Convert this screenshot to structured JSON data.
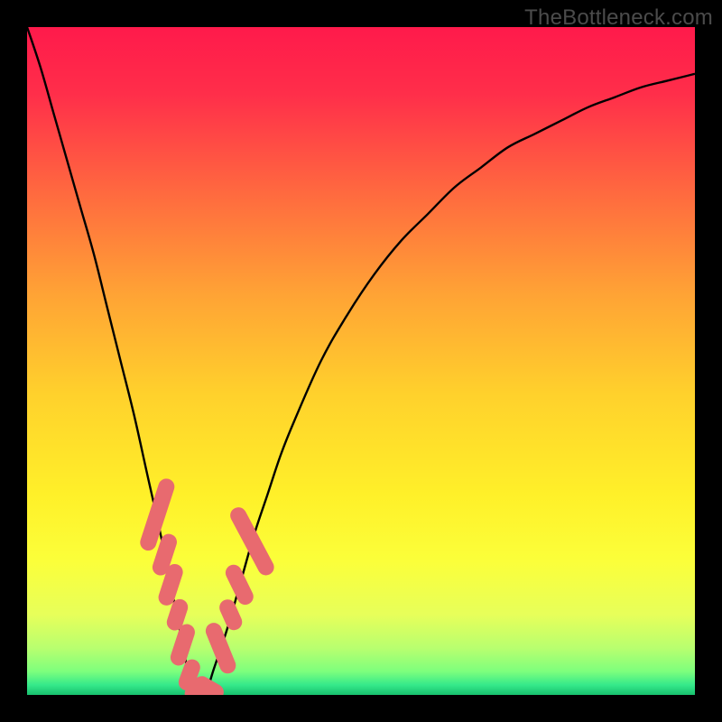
{
  "watermark": "TheBottleneck.com",
  "chart_data": {
    "type": "line",
    "title": "",
    "xlabel": "",
    "ylabel": "",
    "xlim": [
      0,
      100
    ],
    "ylim": [
      0,
      100
    ],
    "series": [
      {
        "name": "bottleneck-curve",
        "x": [
          0,
          2,
          4,
          6,
          8,
          10,
          12,
          14,
          16,
          18,
          20,
          22,
          23,
          24,
          25,
          26,
          27,
          28,
          30,
          32,
          34,
          36,
          38,
          40,
          44,
          48,
          52,
          56,
          60,
          64,
          68,
          72,
          76,
          80,
          84,
          88,
          92,
          96,
          100
        ],
        "y": [
          100,
          94,
          87,
          80,
          73,
          66,
          58,
          50,
          42,
          33,
          24,
          14,
          9,
          4,
          1,
          0,
          1,
          4,
          10,
          17,
          24,
          30,
          36,
          41,
          50,
          57,
          63,
          68,
          72,
          76,
          79,
          82,
          84,
          86,
          88,
          89.5,
          91,
          92,
          93
        ]
      }
    ],
    "markers": [
      {
        "name": "left-cluster-1",
        "x": 19.5,
        "y": 27,
        "len": 7,
        "angle": -72
      },
      {
        "name": "left-cluster-2",
        "x": 20.6,
        "y": 21,
        "len": 4,
        "angle": -72
      },
      {
        "name": "left-cluster-3",
        "x": 21.5,
        "y": 16.5,
        "len": 4,
        "angle": -72
      },
      {
        "name": "left-cluster-4",
        "x": 22.5,
        "y": 12,
        "len": 3,
        "angle": -72
      },
      {
        "name": "left-cluster-5",
        "x": 23.3,
        "y": 7.5,
        "len": 4,
        "angle": -72
      },
      {
        "name": "left-cluster-6",
        "x": 24.3,
        "y": 3,
        "len": 3,
        "angle": -70
      },
      {
        "name": "bottom-1",
        "x": 25.6,
        "y": 0.2,
        "len": 2.5,
        "angle": 0
      },
      {
        "name": "bottom-2",
        "x": 27.2,
        "y": 1.0,
        "len": 3,
        "angle": 30
      },
      {
        "name": "right-cluster-1",
        "x": 29.0,
        "y": 7,
        "len": 5,
        "angle": 68
      },
      {
        "name": "right-cluster-2",
        "x": 30.5,
        "y": 12,
        "len": 3,
        "angle": 66
      },
      {
        "name": "right-cluster-3",
        "x": 31.8,
        "y": 16.5,
        "len": 4,
        "angle": 64
      },
      {
        "name": "right-cluster-4",
        "x": 33.7,
        "y": 23,
        "len": 7,
        "angle": 62
      }
    ],
    "gradient_stops": [
      {
        "offset": 0.0,
        "color": "#ff1a4b"
      },
      {
        "offset": 0.1,
        "color": "#ff2e4a"
      },
      {
        "offset": 0.25,
        "color": "#ff6a3f"
      },
      {
        "offset": 0.4,
        "color": "#ffa335"
      },
      {
        "offset": 0.55,
        "color": "#ffd12c"
      },
      {
        "offset": 0.7,
        "color": "#fff029"
      },
      {
        "offset": 0.8,
        "color": "#fbff3a"
      },
      {
        "offset": 0.88,
        "color": "#e7ff5a"
      },
      {
        "offset": 0.93,
        "color": "#b8ff6f"
      },
      {
        "offset": 0.965,
        "color": "#7dff7d"
      },
      {
        "offset": 0.985,
        "color": "#35e98a"
      },
      {
        "offset": 1.0,
        "color": "#18c06e"
      }
    ],
    "marker_color": "#e86a6f",
    "curve_color": "#000000"
  }
}
